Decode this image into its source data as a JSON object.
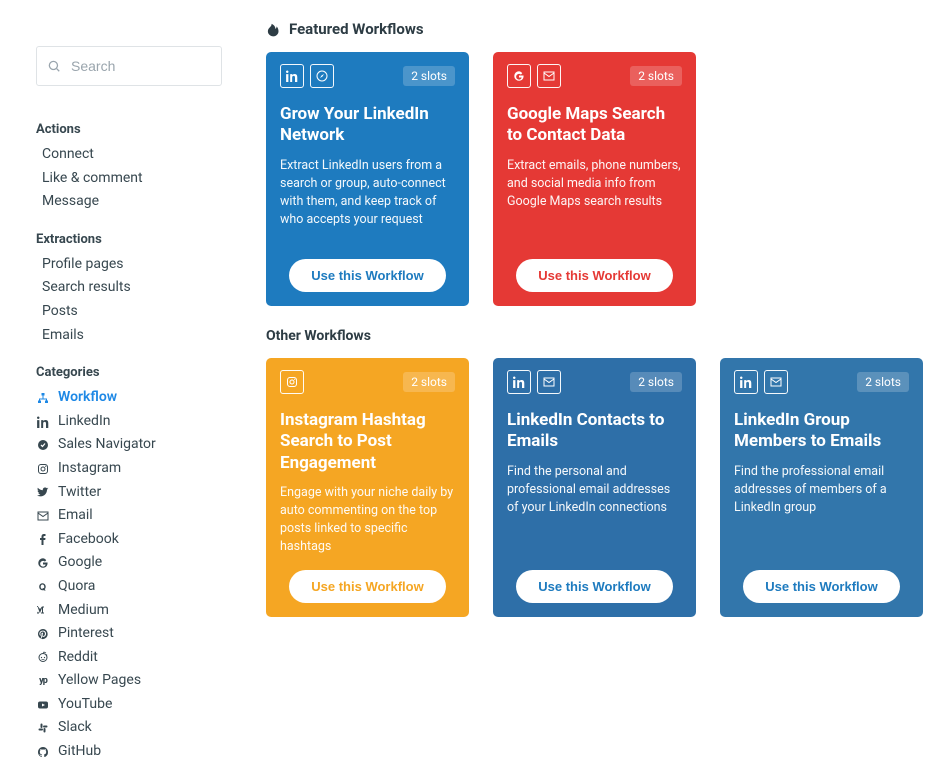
{
  "search": {
    "placeholder": "Search"
  },
  "sections": {
    "actions_title": "Actions",
    "extractions_title": "Extractions",
    "categories_title": "Categories"
  },
  "actions": [
    {
      "label": "Connect"
    },
    {
      "label": "Like & comment"
    },
    {
      "label": "Message"
    }
  ],
  "extractions": [
    {
      "label": "Profile pages"
    },
    {
      "label": "Search results"
    },
    {
      "label": "Posts"
    },
    {
      "label": "Emails"
    }
  ],
  "categories": [
    {
      "label": "Workflow",
      "icon": "sitemap",
      "active": true
    },
    {
      "label": "LinkedIn",
      "icon": "linkedin"
    },
    {
      "label": "Sales Navigator",
      "icon": "compass-check"
    },
    {
      "label": "Instagram",
      "icon": "instagram"
    },
    {
      "label": "Twitter",
      "icon": "twitter"
    },
    {
      "label": "Email",
      "icon": "envelope"
    },
    {
      "label": "Facebook",
      "icon": "facebook"
    },
    {
      "label": "Google",
      "icon": "google"
    },
    {
      "label": "Quora",
      "icon": "quora"
    },
    {
      "label": "Medium",
      "icon": "medium"
    },
    {
      "label": "Pinterest",
      "icon": "pinterest"
    },
    {
      "label": "Reddit",
      "icon": "reddit"
    },
    {
      "label": "Yellow Pages",
      "icon": "yellowpages"
    },
    {
      "label": "YouTube",
      "icon": "youtube"
    },
    {
      "label": "Slack",
      "icon": "slack"
    },
    {
      "label": "GitHub",
      "icon": "github"
    }
  ],
  "featured_title": "Featured Workflows",
  "other_title": "Other Workflows",
  "use_label": "Use this Workflow",
  "featured": [
    {
      "color": "blue",
      "icons": [
        "linkedin",
        "compass"
      ],
      "slots": "2 slots",
      "title": "Grow Your LinkedIn Network",
      "desc": "Extract LinkedIn users from a search or group, auto-connect with them, and keep track of who accepts your request"
    },
    {
      "color": "red",
      "icons": [
        "google",
        "envelope"
      ],
      "slots": "2 slots",
      "title": "Google Maps Search to Contact Data",
      "desc": "Extract emails, phone numbers, and social media info from Google Maps search results"
    }
  ],
  "other": [
    {
      "color": "orange",
      "icons": [
        "instagram"
      ],
      "slots": "2 slots",
      "title": "Instagram Hashtag Search to Post Engagement",
      "desc": "Engage with your niche daily by auto commenting on the top posts linked to specific hashtags"
    },
    {
      "color": "dblue",
      "icons": [
        "linkedin",
        "envelope"
      ],
      "slots": "2 slots",
      "title": "LinkedIn Contacts to Emails",
      "desc": "Find the personal and professional email addresses of your LinkedIn connections"
    },
    {
      "color": "lblue",
      "icons": [
        "linkedin",
        "envelope"
      ],
      "slots": "2 slots",
      "title": "LinkedIn Group Members to Emails",
      "desc": "Find the professional email addresses of members of a LinkedIn group"
    }
  ]
}
